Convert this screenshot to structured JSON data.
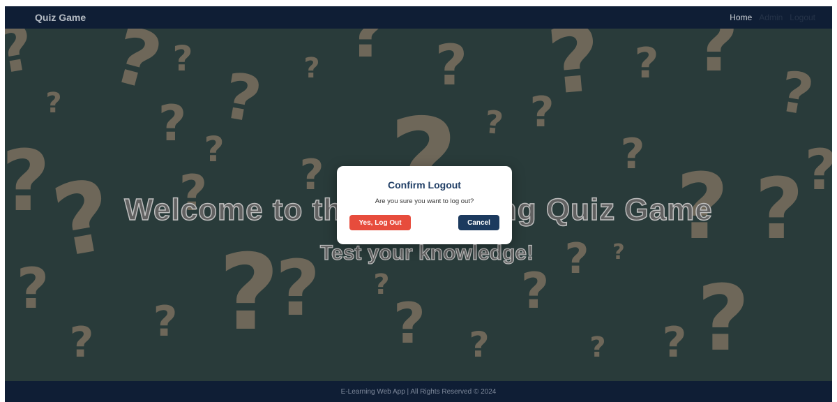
{
  "navbar": {
    "brand": "Quiz Game",
    "links": [
      "Home",
      "Admin",
      "Logout"
    ]
  },
  "hero": {
    "title": "Welcome to the E-Learning Quiz Game",
    "subtitle": "Test your knowledge!"
  },
  "modal": {
    "title": "Confirm Logout",
    "message": "Are you sure you want to log out?",
    "confirm_label": "Yes, Log Out",
    "cancel_label": "Cancel"
  },
  "footer": {
    "text": "E-Learning Web App | All Rights Reserved © 2024"
  },
  "colors": {
    "navbar_bg": "#12233d",
    "hero_bg": "#3e5a55",
    "confirm_button": "#e74c3c",
    "cancel_button": "#1c3a5e",
    "modal_title": "#213f66"
  },
  "background_icon": "question-mark-pattern"
}
